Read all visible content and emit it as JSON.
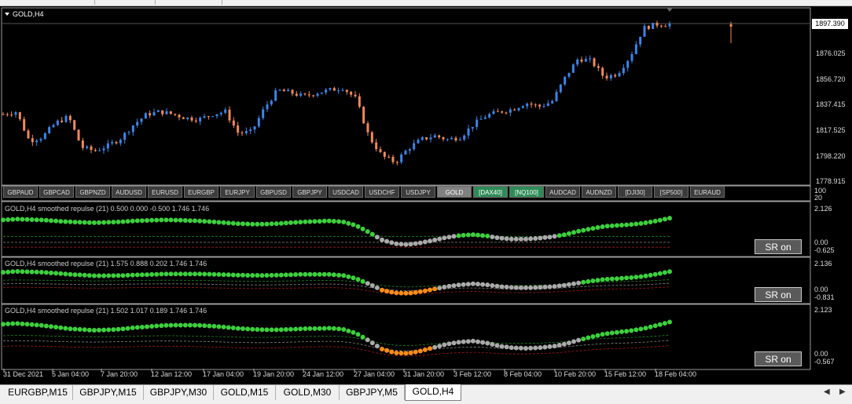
{
  "main_chart": {
    "title": "GOLD,H4",
    "price_levels": [
      "1876.025",
      "1856.720",
      "1837.415",
      "1817.525",
      "1798.220",
      "1778.915"
    ],
    "current_price": "1897.390",
    "up_color": "#3d85e6",
    "down_color": "#f08a5d"
  },
  "symbol_bar": {
    "buttons": [
      "GBPAUD",
      "GBPCAD",
      "GBPNZD",
      "AUDUSD",
      "EURUSD",
      "EURGBP",
      "EURJPY",
      "GBPUSD",
      "GBPJPY",
      "USDCAD",
      "USDCHF",
      "USDJPY",
      "GOLD",
      "[DAX40]",
      "[NQ100]",
      "AUDCAD",
      "AUDNZD",
      "[DJI30]",
      "[SP500]",
      "EURAUD"
    ],
    "active": "GOLD",
    "scale_top": "100",
    "scale_bottom": "20"
  },
  "indicators": [
    {
      "label": "GOLD,H4 smoothed repulse (21) 0.500 0.000 -0.500 1.746 1.746",
      "scale_top": "2.126",
      "scale_zero": "0.00",
      "scale_bottom": "-0.625",
      "button": "SR on"
    },
    {
      "label": "GOLD,H4 smoothed repulse (21) 1.575 0.888 0.202 1.746 1.746",
      "scale_top": "2.136",
      "scale_zero": "0.00",
      "scale_bottom": "-0.831",
      "button": "SR on"
    },
    {
      "label": "GOLD,H4 smoothed repulse (21) 1.502 1.017 0.189 1.746 1.746",
      "scale_top": "2.123",
      "scale_zero": "0.00",
      "scale_bottom": "-0.567",
      "button": "SR on"
    }
  ],
  "time_axis": [
    "31 Dec 2021",
    "5 Jan 04:00",
    "7 Jan 20:00",
    "12 Jan 12:00",
    "17 Jan 04:00",
    "19 Jan 20:00",
    "24 Jan 12:00",
    "27 Jan 04:00",
    "31 Jan 20:00",
    "3 Feb 12:00",
    "8 Feb 04:00",
    "10 Feb 20:00",
    "15 Feb 12:00",
    "18 Feb 04:00"
  ],
  "tabs": [
    "EURGBP,M15",
    "GBPJPY,M15",
    "GBPJPY,M30",
    "GOLD,M15",
    "GOLD,M30",
    "GBPJPY,M5",
    "GOLD,H4"
  ],
  "active_tab": "GOLD,H4",
  "chart_data": {
    "type": "line",
    "title": "GOLD,H4",
    "series": [
      {
        "values": [
          1826,
          1828,
          1805,
          1808,
          1819,
          1824,
          1800,
          1797,
          1801,
          1807,
          1818,
          1826,
          1828,
          1826,
          1823,
          1822,
          1826,
          1828,
          1811,
          1812,
          1831,
          1845,
          1843,
          1840,
          1843,
          1845,
          1847,
          1838,
          1808,
          1793,
          1788,
          1799,
          1806,
          1809,
          1806,
          1808,
          1818,
          1825,
          1828,
          1830,
          1835,
          1832,
          1836,
          1855,
          1870,
          1868,
          1855,
          1858,
          1872,
          1894,
          1897,
          1897
        ]
      }
    ],
    "ylim": [
      1770,
      1905
    ]
  }
}
